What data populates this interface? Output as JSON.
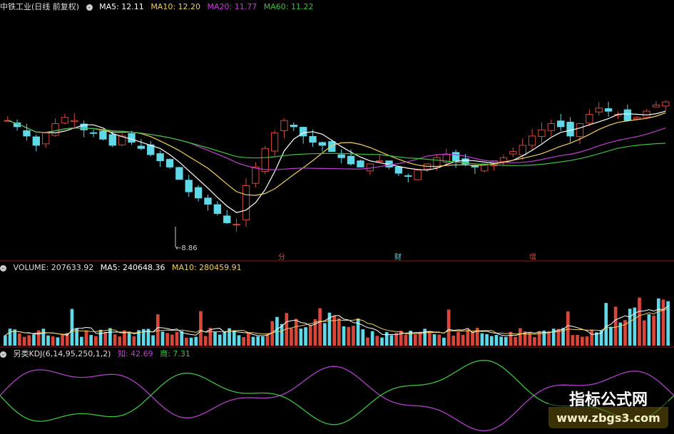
{
  "price_header": {
    "title": "中铁工业(日线 前复权)",
    "ma5": "MA5: 12.11",
    "ma10": "MA10: 12.20",
    "ma20": "MA20: 11.77",
    "ma60": "MA60: 11.22"
  },
  "low_marker": "8.86",
  "events": [
    "分",
    "财",
    "增"
  ],
  "volume_header": {
    "volume": "VOLUME: 207633.92",
    "ma5": "MA5: 240648.36",
    "ma10": "MA10: 280459.91"
  },
  "kdj_header": {
    "name": "另类KDJ(6,14,95,250,1,2)",
    "zhi": "知: 42.69",
    "shang": "商: 7.31"
  },
  "watermark": {
    "line1": "指标公式网",
    "line2": "www.zbgs3.com"
  },
  "colors": {
    "up": "#d9473a",
    "down": "#5fd8e8",
    "ma5": "#ffffff",
    "ma10": "#f0d060",
    "ma20": "#c040d0",
    "ma60": "#40c040",
    "kdj_k": "#b040c8",
    "kdj_d": "#40c040"
  },
  "chart_data": {
    "type": "line",
    "title": "中铁工业(日线 前复权)",
    "price_close": [
      12.3,
      12.1,
      11.8,
      11.5,
      11.9,
      12.2,
      12.4,
      12.3,
      12.0,
      11.9,
      11.7,
      11.5,
      11.8,
      11.6,
      11.4,
      11.2,
      11.0,
      10.8,
      10.4,
      10.0,
      9.8,
      9.6,
      9.3,
      9.0,
      8.95,
      10.2,
      10.8,
      11.4,
      11.9,
      12.3,
      12.1,
      11.8,
      11.6,
      11.5,
      11.3,
      11.1,
      10.9,
      10.8,
      10.9,
      11.0,
      10.8,
      10.6,
      10.5,
      10.7,
      10.9,
      11.1,
      11.2,
      11.0,
      10.9,
      10.8,
      10.9,
      11.0,
      11.1,
      11.3,
      11.5,
      11.8,
      12.0,
      12.2,
      12.1,
      11.8,
      12.2,
      12.5,
      12.7,
      12.6,
      12.5,
      12.3,
      12.4,
      12.6,
      12.8,
      12.9
    ],
    "series": [
      {
        "name": "MA5",
        "value": 12.11
      },
      {
        "name": "MA10",
        "value": 12.2
      },
      {
        "name": "MA20",
        "value": 11.77
      },
      {
        "name": "MA60",
        "value": 11.22
      }
    ]
  }
}
